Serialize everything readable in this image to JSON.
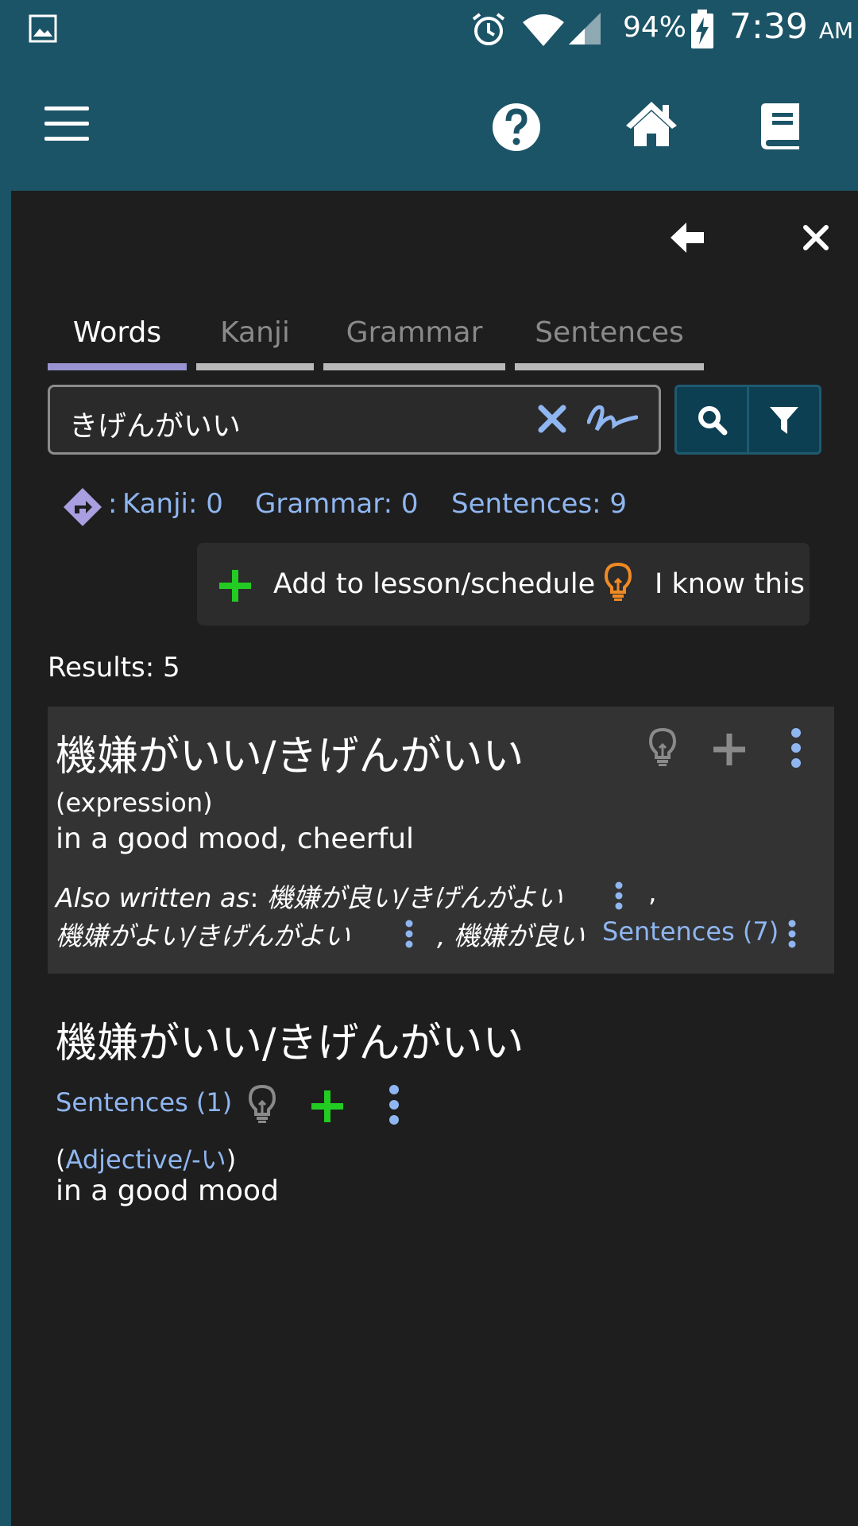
{
  "status_bar": {
    "battery_percent": "94%",
    "time": "7:39",
    "am_pm": "AM",
    "icons": [
      "image-icon",
      "alarm-icon",
      "wifi-icon",
      "signal-icon",
      "battery-charging-icon"
    ]
  },
  "app_bar": {
    "icons": [
      "hamburger-menu-icon",
      "help-icon",
      "home-icon",
      "book-icon"
    ]
  },
  "panel": {
    "icons": [
      "back-arrow-icon",
      "close-icon"
    ]
  },
  "tabs": [
    {
      "label": "Words",
      "active": true
    },
    {
      "label": "Kanji",
      "active": false
    },
    {
      "label": "Grammar",
      "active": false
    },
    {
      "label": "Sentences",
      "active": false
    }
  ],
  "search": {
    "value": "きげんがいい",
    "icons": [
      "clear-icon",
      "handwriting-icon",
      "search-icon",
      "filter-icon"
    ]
  },
  "related": {
    "colon": ":",
    "kanji_link": "Kanji: 0",
    "grammar_link": "Grammar: 0",
    "sentences_link": "Sentences: 9"
  },
  "actions": {
    "add_label": "Add to lesson/schedule",
    "know_label": "I know this"
  },
  "results": {
    "count_text": "Results: 5",
    "entries": [
      {
        "title": "機嫌がいい/きげんがいい",
        "part_of_speech": "(expression)",
        "gloss": "in a good mood, cheerful",
        "also_written_label": "Also written as",
        "also_written_1": "機嫌が良い/きげんがよい",
        "also_written_2": "機嫌がよい/きげんがよい",
        "also_written_3": ", 機嫌が良い",
        "comma": ",",
        "sentences_link": "Sentences (7)"
      },
      {
        "title": "機嫌がいい/きげんがいい",
        "sentences_link": "Sentences (1)",
        "pos_open": "(",
        "pos_link": "Adjective/-い",
        "pos_close": ")",
        "gloss": "in a good mood"
      }
    ]
  },
  "colors": {
    "app_bar": "#1c5467",
    "panel": "#1e1e1e",
    "link": "#8fb6f0",
    "active_tab": "#9993d1",
    "plus_green": "#22cc22",
    "bulb_orange": "#f08a24",
    "more_blue": "#8fb6f0"
  }
}
